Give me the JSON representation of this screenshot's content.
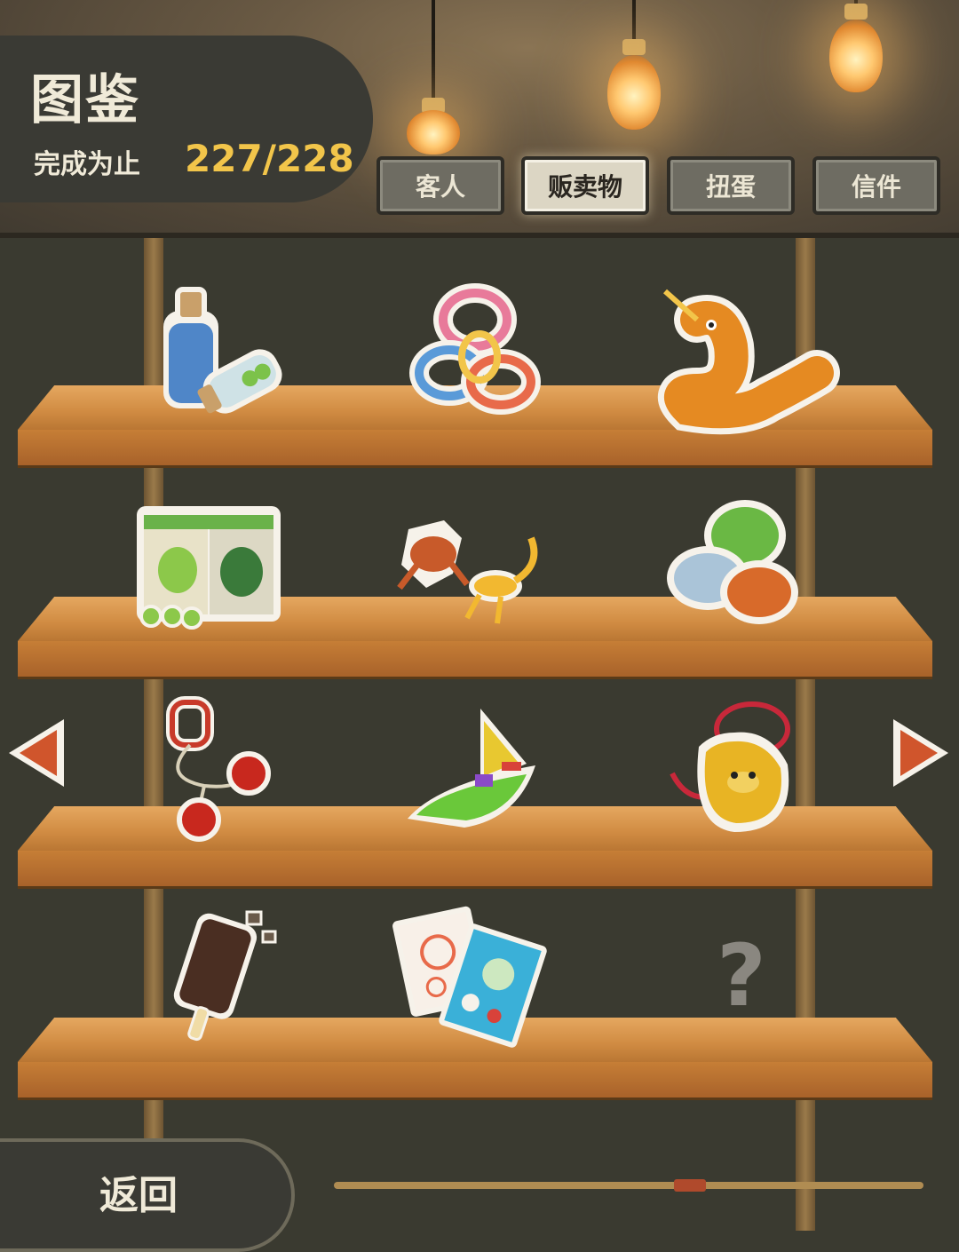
{
  "header": {
    "title": "图鉴",
    "progress_label": "完成为止",
    "progress_value": "227/228"
  },
  "tabs": [
    {
      "label": "客人",
      "active": false
    },
    {
      "label": "贩卖物",
      "active": true
    },
    {
      "label": "扭蛋",
      "active": false
    },
    {
      "label": "信件",
      "active": false
    }
  ],
  "items": [
    {
      "icon": "bottles-icon"
    },
    {
      "icon": "rings-icon"
    },
    {
      "icon": "fuzzy-worm-icon"
    },
    {
      "icon": "apple-candy-box-icon"
    },
    {
      "icon": "frog-scorpion-icon"
    },
    {
      "icon": "marbles-icon"
    },
    {
      "icon": "kendama-icon"
    },
    {
      "icon": "paper-boat-icon"
    },
    {
      "icon": "charm-bag-icon"
    },
    {
      "icon": "ice-pop-icon"
    },
    {
      "icon": "cards-icon"
    },
    {
      "icon": "unknown-item-icon",
      "label": "?"
    }
  ],
  "footer": {
    "back_label": "返回",
    "page_position": 0.61
  },
  "colors": {
    "accent": "#f2c54a",
    "arrow": "#d0552c",
    "wood": "#d08b42",
    "panel": "#3a3a34"
  }
}
